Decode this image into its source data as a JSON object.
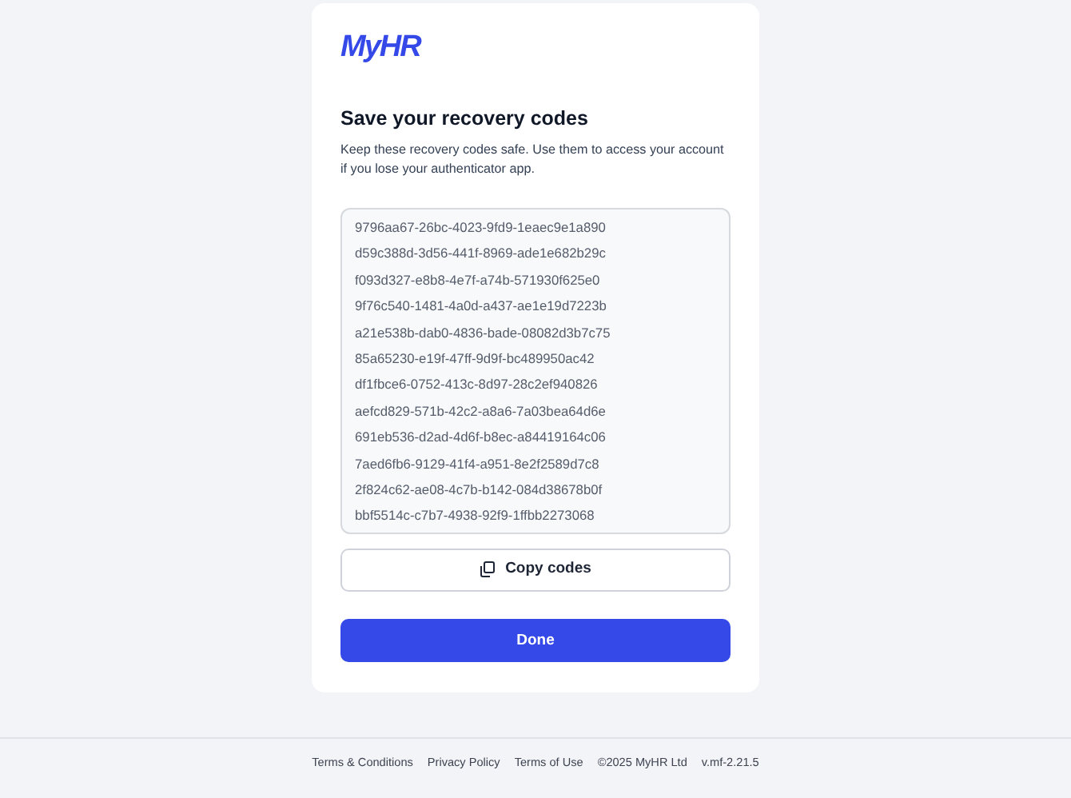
{
  "logo": "MyHR",
  "title": "Save your recovery codes",
  "description": "Keep these recovery codes safe. Use them to access your account if you lose your authenticator app.",
  "codes": [
    "9796aa67-26bc-4023-9fd9-1eaec9e1a890",
    "d59c388d-3d56-441f-8969-ade1e682b29c",
    "f093d327-e8b8-4e7f-a74b-571930f625e0",
    "9f76c540-1481-4a0d-a437-ae1e19d7223b",
    "a21e538b-dab0-4836-bade-08082d3b7c75",
    "85a65230-e19f-47ff-9d9f-bc489950ac42",
    "df1fbce6-0752-413c-8d97-28c2ef940826",
    "aefcd829-571b-42c2-a8a6-7a03bea64d6e",
    "691eb536-d2ad-4d6f-b8ec-a84419164c06",
    "7aed6fb6-9129-41f4-a951-8e2f2589d7c8",
    "2f824c62-ae08-4c7b-b142-084d38678b0f",
    "bbf5514c-c7b7-4938-92f9-1ffbb2273068"
  ],
  "copy_button": "Copy codes",
  "done_button": "Done",
  "footer_links": [
    "Terms & Conditions",
    "Privacy Policy",
    "Terms of Use"
  ],
  "footer_notes": [
    "©2025 MyHR Ltd",
    "v.mf-2.21.5"
  ]
}
